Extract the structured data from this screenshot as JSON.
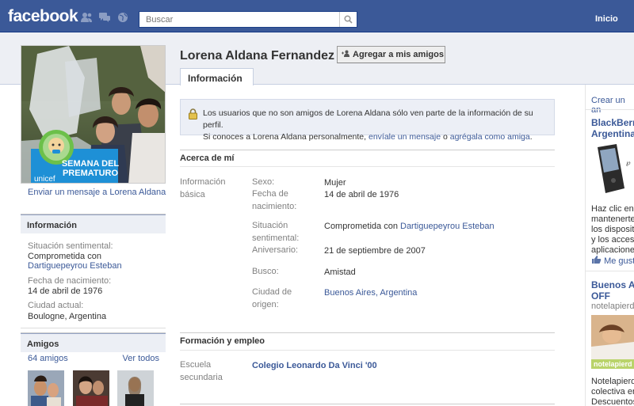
{
  "header": {
    "logo": "facebook",
    "search_placeholder": "Buscar",
    "home": "Inicio"
  },
  "profile": {
    "name": "Lorena Aldana Fernandez",
    "add_friend": "Agregar a mis amigos",
    "tab": "Información",
    "picture_text": {
      "line1": "SEMANA DEL",
      "line2": "PREMATURO",
      "brand": "unicef"
    },
    "send_message": "Enviar un mensaje a Lorena Aldana"
  },
  "sidebar_info": {
    "title": "Información",
    "relationship_label": "Situación sentimental:",
    "relationship_value": "Comprometida con",
    "relationship_partner": "Dartiguepeyrou Esteban",
    "birthday_label": "Fecha de nacimiento:",
    "birthday_value": "14 de abril de 1976",
    "city_label": "Ciudad actual:",
    "city_value": "Boulogne, Argentina"
  },
  "friends": {
    "title": "Amigos",
    "count": "64 amigos",
    "see_all": "Ver todos"
  },
  "notice": {
    "line1": "Los usuarios que no son amigos de Lorena Aldana sólo ven parte de la información de su perfil.",
    "line2_pre": "Si conoces a Lorena Aldana personalmente,",
    "link_message": "envíale un mensaje",
    "line2_mid": "o",
    "link_add": "agrégala como amiga",
    "line2_end": "."
  },
  "about": {
    "title": "Acerca de mí",
    "basic_label": [
      "Información",
      "básica"
    ],
    "sex_label": "Sexo:",
    "sex_value": "Mujer",
    "birth_label": [
      "Fecha de",
      "nacimiento:"
    ],
    "birth_value": "14 de abril de 1976",
    "relationship_label": [
      "Situación",
      "sentimental:"
    ],
    "relationship_value": "Comprometida con",
    "relationship_partner": "Dartiguepeyrou Esteban",
    "anniversary_label": "Aniversario:",
    "anniversary_value": "21 de septiembre de 2007",
    "looking_label": "Busco:",
    "looking_value": "Amistad",
    "hometown_label": [
      "Ciudad de",
      "origen:"
    ],
    "hometown_value": "Buenos Aires, Argentina"
  },
  "education": {
    "title": "Formación y empleo",
    "school_label": [
      "Escuela",
      "secundaria"
    ],
    "school_value": "Colegio Leonardo Da Vinci '00"
  },
  "ads": {
    "create": "Crear un an",
    "ad1": {
      "title": [
        "BlackBerr",
        "Argentina"
      ],
      "text": [
        "Haz clic en \"",
        "mantenerte",
        "los dispositiv",
        "y los acceso",
        "aplicaciones"
      ],
      "like": "Me gust"
    },
    "ad2": {
      "title": [
        "Buenos A",
        "OFF"
      ],
      "source": "notelapierda",
      "brand": "notelapierd",
      "text": [
        "Notelapierda",
        "colectiva en",
        "Descuentos"
      ]
    }
  },
  "colors": {
    "brand_blue": "#3b5998",
    "link": "#3b5998",
    "band": "#edeff4"
  }
}
